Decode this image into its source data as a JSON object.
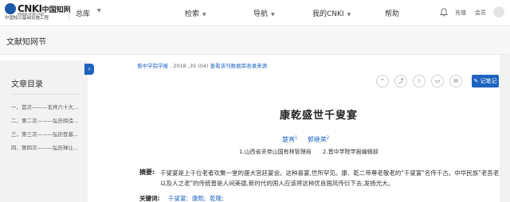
{
  "header": {
    "logo_text": "CNKI",
    "logo_cn": "中国知网",
    "logo_url": "www.cnki.net",
    "logo_subtitle": "中国知识基础设施工程",
    "home_label": "总库",
    "nav": [
      "检索",
      "导航",
      "我的CNKI",
      "帮助"
    ],
    "topup_label": "充值",
    "member_label": "会员"
  },
  "section": {
    "title": "文献知网节"
  },
  "toc": {
    "title": "文章目录",
    "items": [
      "一、首次———玄烨六十大...",
      "二、第二次———弘历缔造...",
      "三、第三次———弘历登基...",
      "四、第四次———弘历禅让..."
    ]
  },
  "article": {
    "source_journal": "晋中学院学报",
    "source_issue": ". 2018 ,35 (04)",
    "source_link": "查看该刊数据库收录来源",
    "notes_label": "记笔记",
    "title": "康乾盛世千叟宴",
    "authors": [
      {
        "name": "楚宵",
        "sup": "1"
      },
      {
        "name": "郭继荣",
        "sup": "2"
      }
    ],
    "affiliations": [
      "1.山西省关帝山国有林管理局",
      "2.晋中学院学报编辑部"
    ],
    "abstract_label": "摘要:",
    "abstract": "千叟宴是上千位老者欢聚一堂的盛大宫廷宴会。这种喜宴,世所罕见。康、乾二帝尊老敬老的\"千叟宴\"名传千古。中华民族\"老吾老以及人之老\"的传统普是人间美德,新时代的国人应该将这种优良国风传衍下去,发扬光大。",
    "keywords_label": "关键词:",
    "keywords": [
      "千叟宴;",
      "康熙;",
      "乾隆;"
    ]
  },
  "colors": {
    "accent": "#1d63bf",
    "toc_bg": "#f2f2f2"
  },
  "icons": {
    "toolbar": [
      "quote-icon",
      "share-icon",
      "favorite-icon",
      "print-icon",
      "mail-icon",
      "more-icon"
    ]
  }
}
